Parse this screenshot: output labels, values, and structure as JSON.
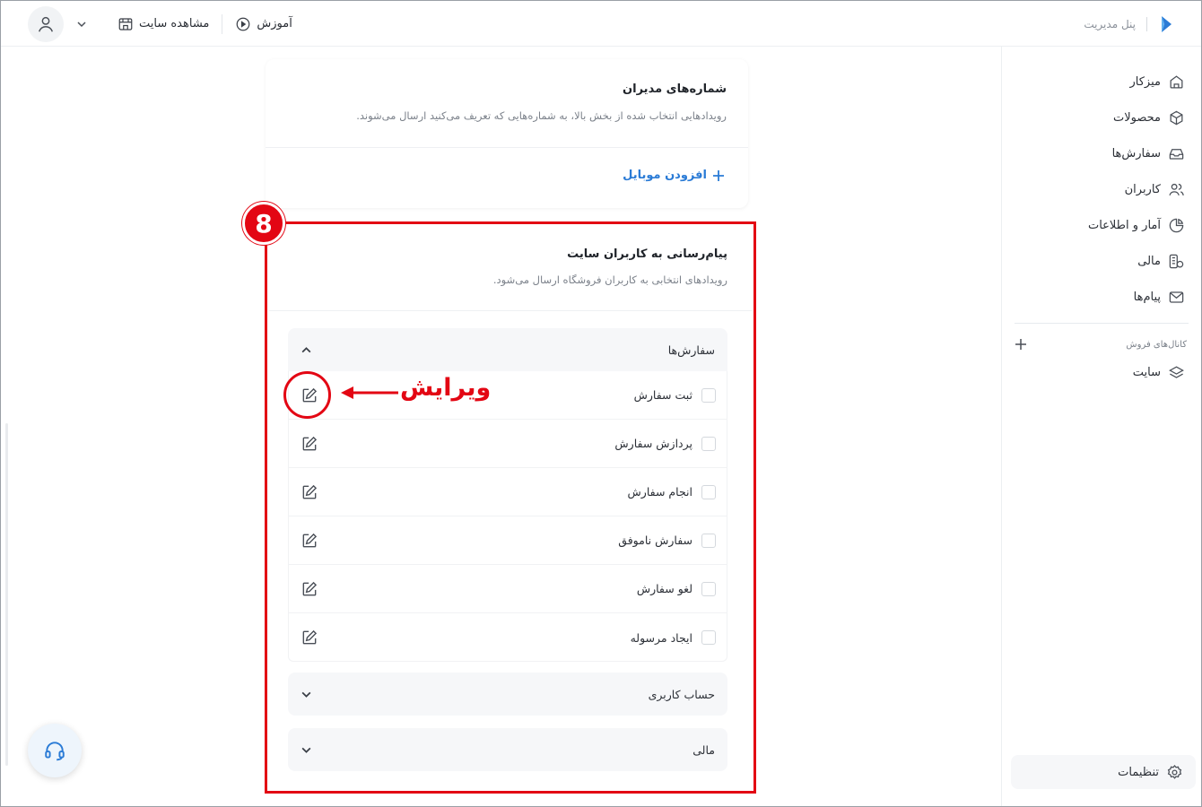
{
  "topbar": {
    "brand_text": "پنل مدیریت",
    "tutorial_label": "آموزش",
    "view_site_label": "مشاهده سایت"
  },
  "sidebar": {
    "items": [
      {
        "label": "میزکار",
        "icon": "home-icon"
      },
      {
        "label": "محصولات",
        "icon": "box-icon"
      },
      {
        "label": "سفارش‌ها",
        "icon": "inbox-icon"
      },
      {
        "label": "کاربران",
        "icon": "users-icon"
      },
      {
        "label": "آمار و اطلاعات",
        "icon": "pie-chart-icon"
      },
      {
        "label": "مالی",
        "icon": "coins-icon"
      },
      {
        "label": "پیام‌ها",
        "icon": "mail-icon"
      }
    ],
    "channels_label": "کانال‌های فروش",
    "site_label": "سایت",
    "settings_label": "تنظیمات"
  },
  "admins_card": {
    "title": "شماره‌های مدیران",
    "subtitle": "رویدادهایی انتخاب شده از بخش بالا، به شماره‌هایی که تعریف می‌کنید ارسال می‌شوند.",
    "add_mobile_label": "افزودن موبایل"
  },
  "users_card": {
    "step_number": "8",
    "title": "پیام‌رسانی به کاربران سایت",
    "subtitle": "رویدادهای انتخابی به کاربران فروشگاه ارسال می‌شود.",
    "groups": {
      "orders": {
        "title": "سفارش‌ها",
        "rows": [
          {
            "label": "ثبت سفارش"
          },
          {
            "label": "پردازش سفارش"
          },
          {
            "label": "انجام سفارش"
          },
          {
            "label": "سفارش ناموفق"
          },
          {
            "label": "لغو سفارش"
          },
          {
            "label": "ایجاد مرسوله"
          }
        ]
      },
      "account": {
        "title": "حساب کاربری"
      },
      "finance": {
        "title": "مالی"
      }
    },
    "annotation": "ویرایش"
  },
  "colors": {
    "accent": "#2a7bd6",
    "highlight": "#e30613"
  }
}
